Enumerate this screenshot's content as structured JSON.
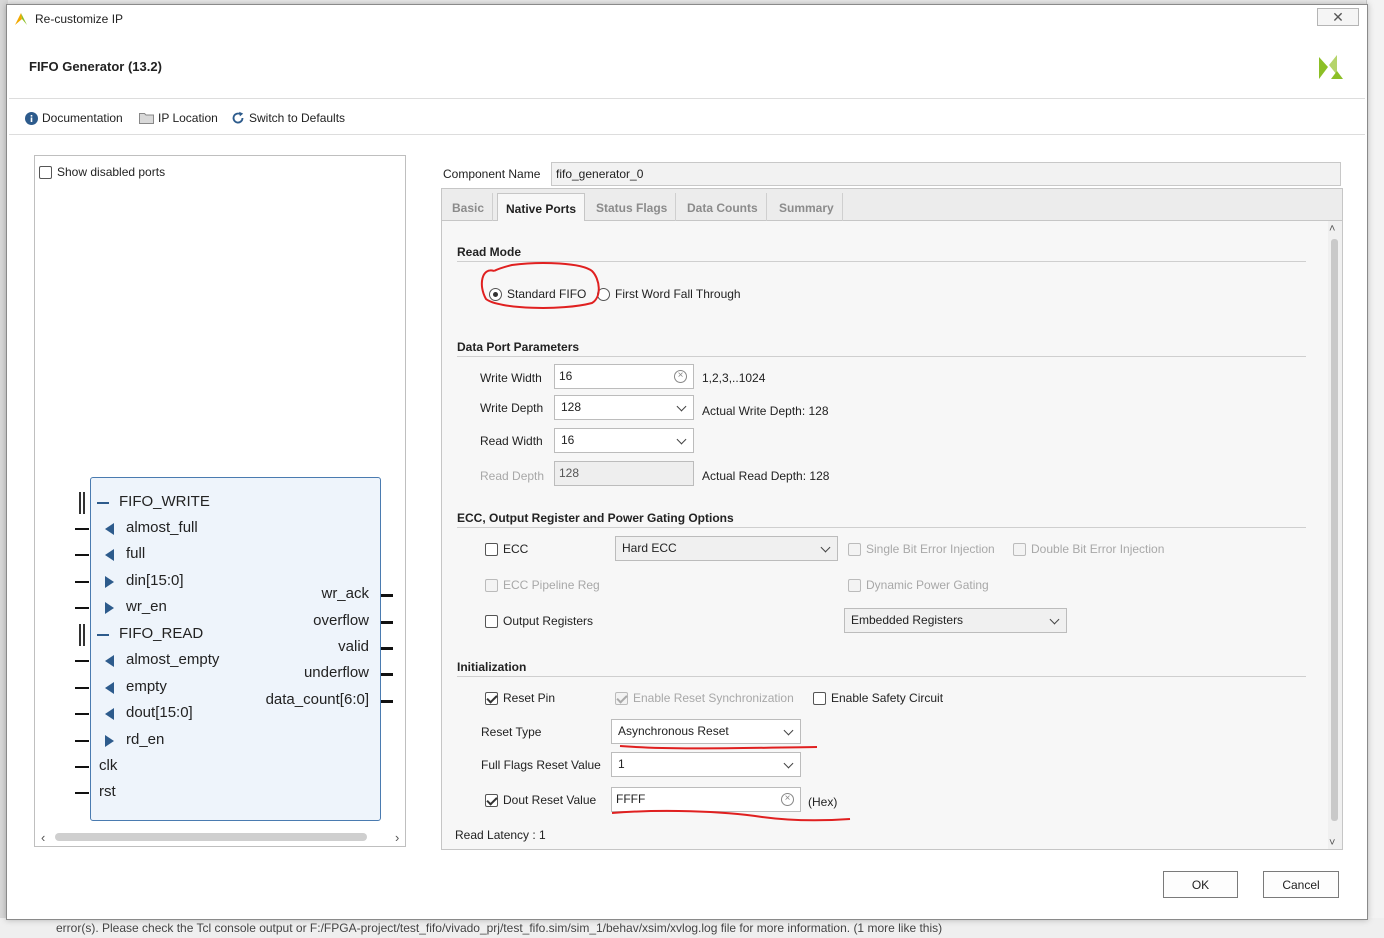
{
  "window": {
    "title": "Re-customize IP"
  },
  "header": {
    "ip_title": "FIFO Generator (13.2)"
  },
  "toolbar": {
    "documentation": "Documentation",
    "ip_location": "IP Location",
    "switch_defaults": "Switch to Defaults"
  },
  "left_panel": {
    "show_disabled_ports": "Show disabled ports",
    "symbol": {
      "write_group": "FIFO_WRITE",
      "read_group": "FIFO_READ",
      "left_ports": [
        "almost_full",
        "full",
        "din[15:0]",
        "wr_en",
        "almost_empty",
        "empty",
        "dout[15:0]",
        "rd_en"
      ],
      "clk": "clk",
      "rst": "rst",
      "right_ports": [
        "wr_ack",
        "overflow",
        "valid",
        "underflow",
        "data_count[6:0]"
      ]
    }
  },
  "component": {
    "label": "Component Name",
    "value": "fifo_generator_0"
  },
  "tabs": [
    "Basic",
    "Native Ports",
    "Status Flags",
    "Data Counts",
    "Summary"
  ],
  "read_mode": {
    "title": "Read Mode",
    "standard": "Standard FIFO",
    "fwft": "First Word Fall Through"
  },
  "data_port": {
    "title": "Data Port Parameters",
    "write_width_label": "Write Width",
    "write_width_value": "16",
    "write_width_range": "1,2,3,..1024",
    "write_depth_label": "Write Depth",
    "write_depth_value": "128",
    "actual_write_depth": "Actual Write Depth: 128",
    "read_width_label": "Read Width",
    "read_width_value": "16",
    "read_depth_label": "Read Depth",
    "read_depth_value": "128",
    "actual_read_depth": "Actual Read Depth: 128"
  },
  "ecc": {
    "title": "ECC, Output Register and Power Gating Options",
    "ecc_label": "ECC",
    "ecc_select": "Hard ECC",
    "single_bit": "Single Bit Error Injection",
    "double_bit": "Double Bit Error Injection",
    "ecc_pipeline": "ECC Pipeline Reg",
    "dynamic_power": "Dynamic Power Gating",
    "output_registers": "Output Registers",
    "registers_select": "Embedded Registers"
  },
  "init": {
    "title": "Initialization",
    "reset_pin": "Reset Pin",
    "enable_reset_sync": "Enable Reset Synchronization",
    "enable_safety": "Enable Safety Circuit",
    "reset_type_label": "Reset Type",
    "reset_type_value": "Asynchronous Reset",
    "full_flags_label": "Full Flags Reset Value",
    "full_flags_value": "1",
    "dout_reset_label": "Dout Reset Value",
    "dout_reset_value": "FFFF",
    "hex": "(Hex)"
  },
  "read_latency": "Read Latency : 1",
  "buttons": {
    "ok": "OK",
    "cancel": "Cancel"
  },
  "status_bar": "error(s). Please check the Tcl console output or F:/FPGA-project/test_fifo/vivado_prj/test_fifo.sim/sim_1/behav/xsim/xvlog.log file for more information. (1 more like this)",
  "colors": {
    "annotation": "#e02020",
    "symbol_border": "#4a7bb0",
    "symbol_fill": "#eef4fb",
    "logo": "#8cbf26"
  }
}
